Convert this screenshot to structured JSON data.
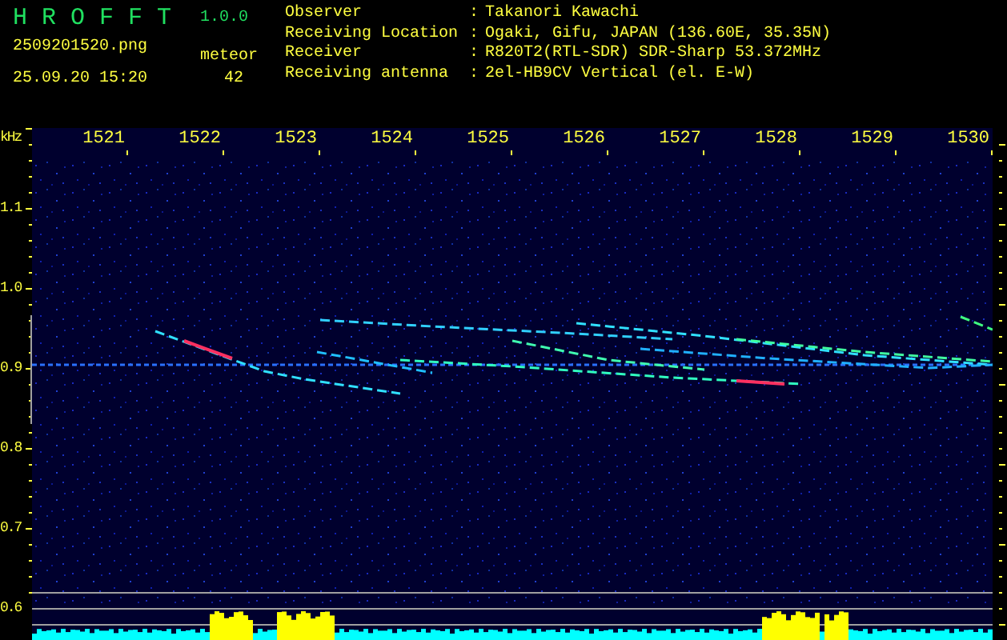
{
  "app": {
    "title": "H R O F F T",
    "version": "1.0.0"
  },
  "file": {
    "name": "2509201520.png",
    "datetime": "25.09.20 15:20"
  },
  "counter": {
    "label": "meteor",
    "value": "42"
  },
  "info": [
    {
      "label": "Observer",
      "separator": ":",
      "value": "Takanori Kawachi"
    },
    {
      "label": "Receiving Location",
      "separator": ":",
      "value": "Ogaki, Gifu, JAPAN (136.60E, 35.35N)"
    },
    {
      "label": "Receiver",
      "separator": ":",
      "value": "R820T2(RTL-SDR) SDR-Sharp 53.372MHz"
    },
    {
      "label": "Receiving antenna",
      "separator": ":",
      "value": "2el-HB9CV Vertical (el. E-W)"
    }
  ],
  "y_axis": {
    "unit": "kHz",
    "labels": [
      "1.1",
      "1.0",
      "0.9",
      "0.8",
      "0.7",
      "0.6"
    ]
  },
  "x_axis": {
    "labels": [
      "1521",
      "1522",
      "1523",
      "1524",
      "1525",
      "1526",
      "1527",
      "1528",
      "1529",
      "1530"
    ]
  }
}
